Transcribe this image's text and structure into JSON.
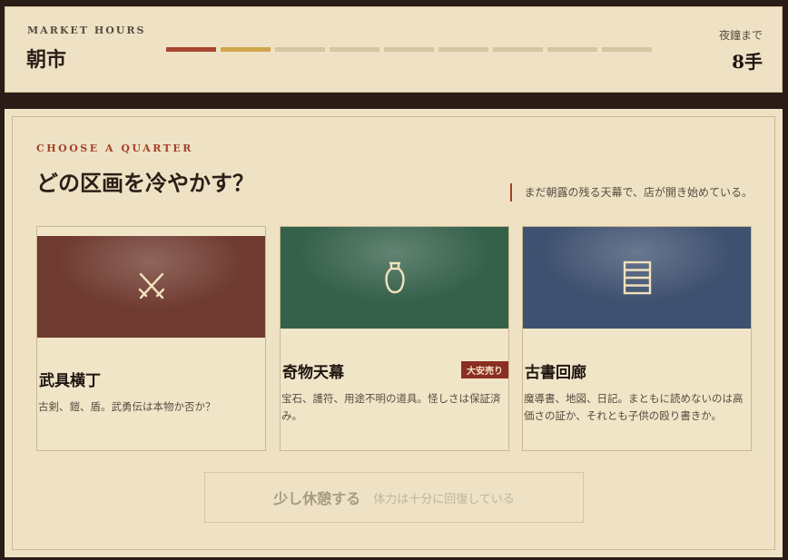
{
  "market": {
    "label": "MARKET HOURS",
    "title": "朝市",
    "segments": [
      "past",
      "current",
      "future",
      "future",
      "future",
      "future",
      "future",
      "future",
      "future"
    ],
    "night_label": "夜鐘まで",
    "night_value": "8手"
  },
  "quarter": {
    "label": "CHOOSE A QUARTER",
    "title": "どの区画を冷やかす？",
    "flavor": "まだ朝露の残る天幕で、店が開き始めている。",
    "cards": [
      {
        "name": "武具横丁",
        "desc": "古剣、鎧、盾。武勇伝は本物か否か？",
        "color": "#6f3a2f",
        "icon": "crossed-swords-icon"
      },
      {
        "name": "奇物天幕",
        "desc": "宝石、護符、用途不明の道具。怪しさは保証済み。",
        "color": "#35614b",
        "icon": "vase-icon",
        "badge": "大安売り"
      },
      {
        "name": "古書回廊",
        "desc": "魔導書、地図、日記。まともに読めないのは高価さの証か、それとも子供の殴り書きか。",
        "color": "#3f5170",
        "icon": "book-stack-icon"
      }
    ]
  },
  "rest": {
    "label": "少し休憩する",
    "note": "体力は十分に回復している"
  }
}
